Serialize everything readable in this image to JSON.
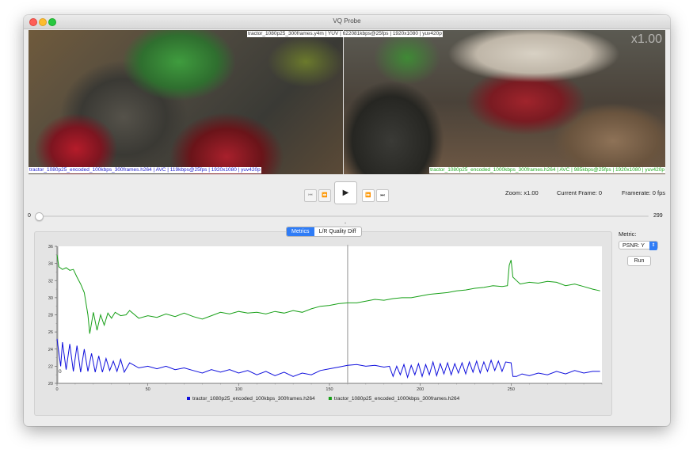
{
  "window": {
    "title": "VQ Probe"
  },
  "video": {
    "top_caption": "tractor_1080p25_300frames.y4m | YUV | 622081kbps@25fps | 1920x1080 | yuv420p",
    "left_caption": "tractor_1080p25_encoded_100kbps_300frames.h264 | AVC | 119kbps@25fps | 1920x1080 | yuv420p",
    "right_caption": "tractor_1080p25_encoded_1000kbps_300frames.h264 | AVC | 985kbps@25fps | 1920x1080 | yuv420p",
    "zoom_overlay": "x1.00"
  },
  "controls": {
    "first": "⏮",
    "prev": "⏪",
    "play": "▶",
    "next": "⏩",
    "last": "⏭",
    "zoom": "Zoom:  x1.00",
    "current_frame": "Current Frame:  0",
    "framerate": "Framerate:  0  fps"
  },
  "slider": {
    "min_label": "0",
    "max_label": "299",
    "value": 0
  },
  "tabs": [
    {
      "label": "Metrics",
      "active": true
    },
    {
      "label": "L/R Quality Diff",
      "active": false
    }
  ],
  "sidebar": {
    "metric_label": "Metric:",
    "metric_value": "PSNR: Y",
    "run_label": "Run"
  },
  "colors": {
    "accent": "#2f7cf6",
    "series_blue": "#1010dd",
    "series_green": "#18a018"
  },
  "chart_data": {
    "type": "line",
    "xlim": [
      0,
      300
    ],
    "ylim": [
      20,
      36
    ],
    "x_ticks": [
      "0",
      "50",
      "100",
      "150",
      "200",
      "250"
    ],
    "y_ticks": [
      "20",
      "22",
      "24",
      "26",
      "28",
      "30",
      "32",
      "34",
      "36"
    ],
    "cursor_x": 160,
    "point_label": "0",
    "series": [
      {
        "name": "tractor_1080p25_encoded_100kbps_300frames.h264",
        "color": "#1010dd",
        "points": [
          [
            0,
            25.2
          ],
          [
            2,
            22.0
          ],
          [
            3,
            24.8
          ],
          [
            5,
            21.6
          ],
          [
            7,
            24.6
          ],
          [
            9,
            21.4
          ],
          [
            11,
            24.4
          ],
          [
            13,
            21.3
          ],
          [
            15,
            24.0
          ],
          [
            17,
            21.4
          ],
          [
            19,
            23.5
          ],
          [
            21,
            21.3
          ],
          [
            23,
            23.2
          ],
          [
            25,
            21.3
          ],
          [
            27,
            22.9
          ],
          [
            29,
            21.5
          ],
          [
            31,
            22.6
          ],
          [
            33,
            21.4
          ],
          [
            35,
            22.8
          ],
          [
            37,
            21.3
          ],
          [
            40,
            22.4
          ],
          [
            45,
            21.8
          ],
          [
            50,
            22.0
          ],
          [
            55,
            21.7
          ],
          [
            60,
            22.0
          ],
          [
            65,
            21.6
          ],
          [
            70,
            21.8
          ],
          [
            75,
            21.5
          ],
          [
            80,
            21.2
          ],
          [
            85,
            21.6
          ],
          [
            90,
            21.3
          ],
          [
            95,
            21.6
          ],
          [
            100,
            21.2
          ],
          [
            105,
            21.5
          ],
          [
            110,
            21.0
          ],
          [
            115,
            21.4
          ],
          [
            120,
            20.9
          ],
          [
            125,
            21.3
          ],
          [
            130,
            20.8
          ],
          [
            135,
            21.2
          ],
          [
            140,
            21.0
          ],
          [
            145,
            21.5
          ],
          [
            150,
            21.7
          ],
          [
            155,
            21.9
          ],
          [
            160,
            22.1
          ],
          [
            165,
            22.2
          ],
          [
            170,
            22.0
          ],
          [
            175,
            22.1
          ],
          [
            180,
            21.9
          ],
          [
            183,
            22.0
          ],
          [
            185,
            20.8
          ],
          [
            187,
            22.0
          ],
          [
            189,
            21.0
          ],
          [
            191,
            22.2
          ],
          [
            193,
            20.7
          ],
          [
            195,
            22.1
          ],
          [
            197,
            21.0
          ],
          [
            199,
            22.3
          ],
          [
            201,
            20.8
          ],
          [
            203,
            22.2
          ],
          [
            205,
            21.0
          ],
          [
            207,
            22.5
          ],
          [
            209,
            20.9
          ],
          [
            211,
            22.3
          ],
          [
            213,
            21.1
          ],
          [
            215,
            22.4
          ],
          [
            217,
            21.0
          ],
          [
            219,
            22.3
          ],
          [
            221,
            21.2
          ],
          [
            223,
            22.4
          ],
          [
            225,
            21.1
          ],
          [
            227,
            22.5
          ],
          [
            229,
            21.3
          ],
          [
            231,
            22.6
          ],
          [
            233,
            21.2
          ],
          [
            235,
            22.5
          ],
          [
            237,
            21.4
          ],
          [
            239,
            22.7
          ],
          [
            241,
            21.5
          ],
          [
            243,
            22.6
          ],
          [
            245,
            21.4
          ],
          [
            247,
            22.5
          ],
          [
            250,
            22.4
          ],
          [
            251,
            20.8
          ],
          [
            253,
            20.8
          ],
          [
            256,
            21.1
          ],
          [
            260,
            20.9
          ],
          [
            265,
            21.2
          ],
          [
            270,
            21.0
          ],
          [
            275,
            21.4
          ],
          [
            280,
            21.1
          ],
          [
            285,
            21.5
          ],
          [
            290,
            21.2
          ],
          [
            295,
            21.4
          ],
          [
            299,
            21.4
          ]
        ]
      },
      {
        "name": "tractor_1080p25_encoded_1000kbps_300frames.h264",
        "color": "#18a018",
        "points": [
          [
            0,
            35.0
          ],
          [
            1,
            33.6
          ],
          [
            3,
            33.3
          ],
          [
            5,
            33.5
          ],
          [
            7,
            33.2
          ],
          [
            9,
            33.3
          ],
          [
            11,
            32.4
          ],
          [
            13,
            31.6
          ],
          [
            15,
            30.6
          ],
          [
            17,
            28.0
          ],
          [
            18,
            25.8
          ],
          [
            20,
            28.3
          ],
          [
            22,
            26.2
          ],
          [
            24,
            28.0
          ],
          [
            26,
            26.8
          ],
          [
            28,
            28.2
          ],
          [
            30,
            27.6
          ],
          [
            32,
            28.3
          ],
          [
            35,
            27.9
          ],
          [
            38,
            28.0
          ],
          [
            40,
            28.5
          ],
          [
            45,
            27.6
          ],
          [
            50,
            27.9
          ],
          [
            55,
            27.7
          ],
          [
            60,
            28.1
          ],
          [
            65,
            27.8
          ],
          [
            70,
            28.2
          ],
          [
            75,
            27.8
          ],
          [
            80,
            27.5
          ],
          [
            85,
            27.9
          ],
          [
            90,
            28.3
          ],
          [
            95,
            28.1
          ],
          [
            100,
            28.4
          ],
          [
            105,
            28.2
          ],
          [
            110,
            28.3
          ],
          [
            115,
            28.1
          ],
          [
            120,
            28.4
          ],
          [
            125,
            28.2
          ],
          [
            130,
            28.5
          ],
          [
            135,
            28.3
          ],
          [
            140,
            28.7
          ],
          [
            145,
            29.0
          ],
          [
            150,
            29.1
          ],
          [
            155,
            29.3
          ],
          [
            160,
            29.4
          ],
          [
            165,
            29.4
          ],
          [
            170,
            29.6
          ],
          [
            175,
            29.8
          ],
          [
            180,
            29.7
          ],
          [
            185,
            29.9
          ],
          [
            190,
            30.0
          ],
          [
            195,
            30.0
          ],
          [
            200,
            30.2
          ],
          [
            205,
            30.4
          ],
          [
            210,
            30.5
          ],
          [
            215,
            30.6
          ],
          [
            220,
            30.8
          ],
          [
            225,
            30.9
          ],
          [
            230,
            31.1
          ],
          [
            235,
            31.2
          ],
          [
            240,
            31.4
          ],
          [
            245,
            31.3
          ],
          [
            248,
            31.4
          ],
          [
            249,
            33.8
          ],
          [
            250,
            34.4
          ],
          [
            251,
            32.4
          ],
          [
            253,
            32.0
          ],
          [
            255,
            31.6
          ],
          [
            260,
            31.8
          ],
          [
            265,
            31.7
          ],
          [
            270,
            31.9
          ],
          [
            275,
            31.8
          ],
          [
            280,
            31.4
          ],
          [
            285,
            31.6
          ],
          [
            290,
            31.3
          ],
          [
            295,
            31.0
          ],
          [
            299,
            30.8
          ]
        ]
      }
    ],
    "legend_placement": "bottom"
  }
}
